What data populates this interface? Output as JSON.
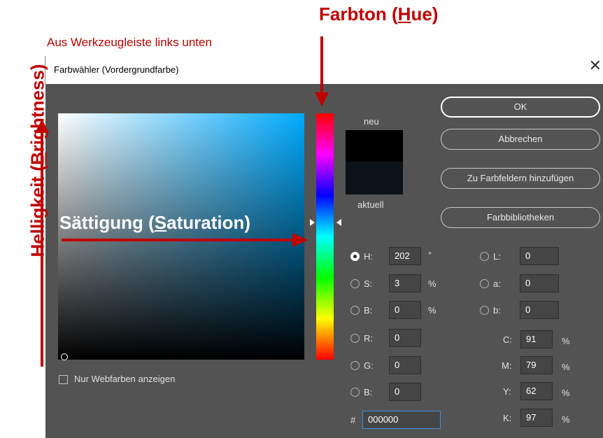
{
  "annotations": {
    "source_note": "Aus Werkzeugleiste links unten",
    "hue_pre": "Farbton (",
    "hue_u": "H",
    "hue_post": "ue)",
    "saturation_pre": "Sättigung (",
    "saturation_u": "S",
    "saturation_post": "aturation)",
    "brightness_pre": "Helligkeit (",
    "brightness_u": "B",
    "brightness_post": "rightness)"
  },
  "dialog": {
    "title": "Farbwähler (Vordergrundfarbe)",
    "close_glyph": "✕"
  },
  "swatch": {
    "new_label": "neu",
    "current_label": "aktuell",
    "new_color": "#000000",
    "current_color": "#0b1218"
  },
  "buttons": {
    "ok": "OK",
    "cancel": "Abbrechen",
    "add_to_swatches": "Zu Farbfeldern hinzufügen",
    "libraries": "Farbbibliotheken"
  },
  "hsb": {
    "h_label": "H:",
    "h_value": "202",
    "h_unit": "°",
    "s_label": "S:",
    "s_value": "3",
    "s_unit": "%",
    "b_label": "B:",
    "b_value": "0",
    "b_unit": "%"
  },
  "rgb": {
    "r_label": "R:",
    "r_value": "0",
    "g_label": "G:",
    "g_value": "0",
    "b_label": "B:",
    "b_value": "0"
  },
  "lab": {
    "l_label": "L:",
    "l_value": "0",
    "a_label": "a:",
    "a_value": "0",
    "b_label": "b:",
    "b_value": "0"
  },
  "cmyk": {
    "c_label": "C:",
    "c_value": "91",
    "m_label": "M:",
    "m_value": "79",
    "y_label": "Y:",
    "y_value": "62",
    "k_label": "K:",
    "k_value": "97",
    "unit": "%"
  },
  "hex": {
    "label": "#",
    "value": "000000"
  },
  "webcolors": {
    "label": "Nur Webfarben anzeigen"
  },
  "colors": {
    "annotation_red": "#c00000",
    "dialog_bg": "#535353"
  }
}
